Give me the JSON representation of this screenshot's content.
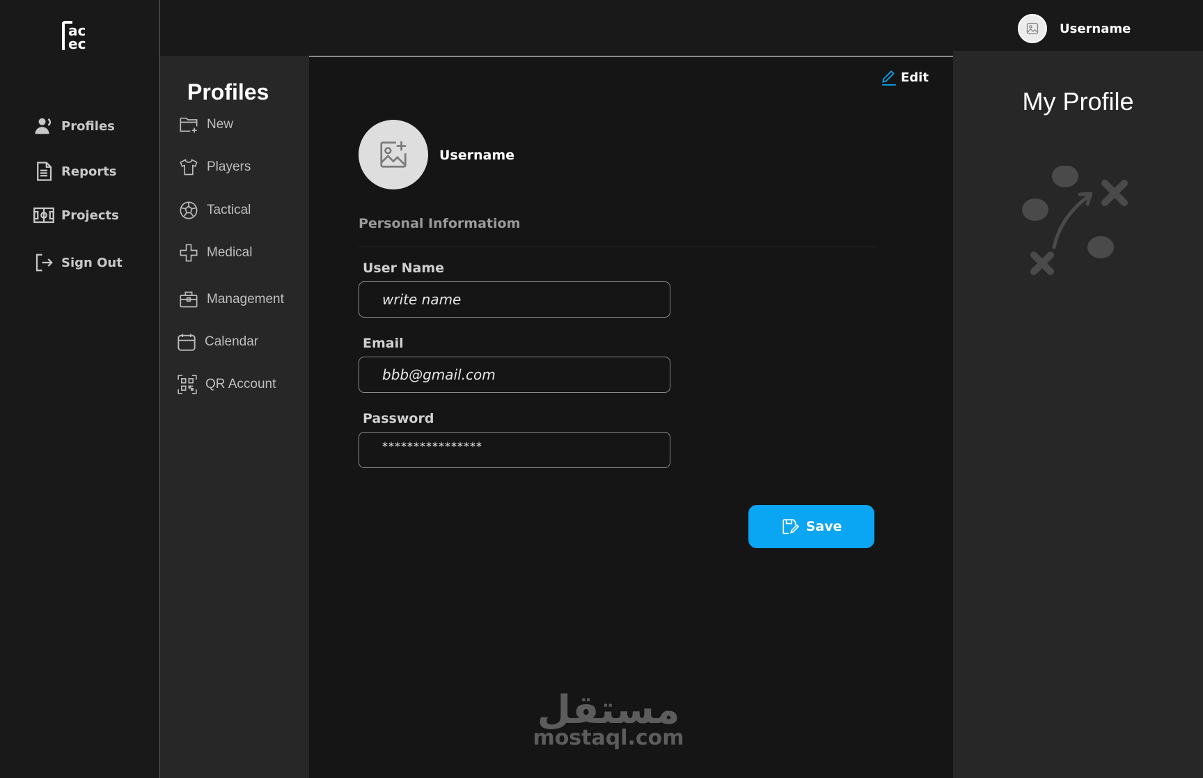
{
  "header": {
    "username": "Username",
    "avatar_icon": "image-icon"
  },
  "logo": {
    "text": "ac ec",
    "icon": "brand-logo"
  },
  "nav": {
    "items": [
      {
        "label": "Profiles",
        "icon": "user-icon"
      },
      {
        "label": "Reports",
        "icon": "document-icon"
      },
      {
        "label": "Projects",
        "icon": "field-icon"
      },
      {
        "label": "Sign Out",
        "icon": "sign-out-icon"
      }
    ]
  },
  "submenu": {
    "title": "Profiles",
    "items": [
      {
        "label": "New",
        "icon": "folder-plus-icon"
      },
      {
        "label": "Players",
        "icon": "shirt-icon"
      },
      {
        "label": "Tactical",
        "icon": "football-icon"
      },
      {
        "label": "Medical",
        "icon": "medical-cross-icon"
      },
      {
        "label": "Management",
        "icon": "briefcase-icon"
      },
      {
        "label": "Calendar",
        "icon": "calendar-icon"
      },
      {
        "label": "QR Account",
        "icon": "qr-code-icon"
      }
    ]
  },
  "profile": {
    "edit_label": "Edit",
    "username": "Username",
    "section_title": "Personal Informatiom",
    "fields": {
      "username_label": "User Name",
      "username_value": "write name",
      "email_label": "Email",
      "email_value": "bbb@gmail.com",
      "password_label": "Password",
      "password_value": "****************"
    },
    "save_label": "Save"
  },
  "right_panel": {
    "title": "My Profile",
    "illustration": "tactic-diagram-icon"
  },
  "watermark": {
    "arabic": "مستقل",
    "latin": "mostaql.com"
  },
  "colors": {
    "accent": "#0aa6f3",
    "background": "#151515",
    "panel": "#272727"
  }
}
